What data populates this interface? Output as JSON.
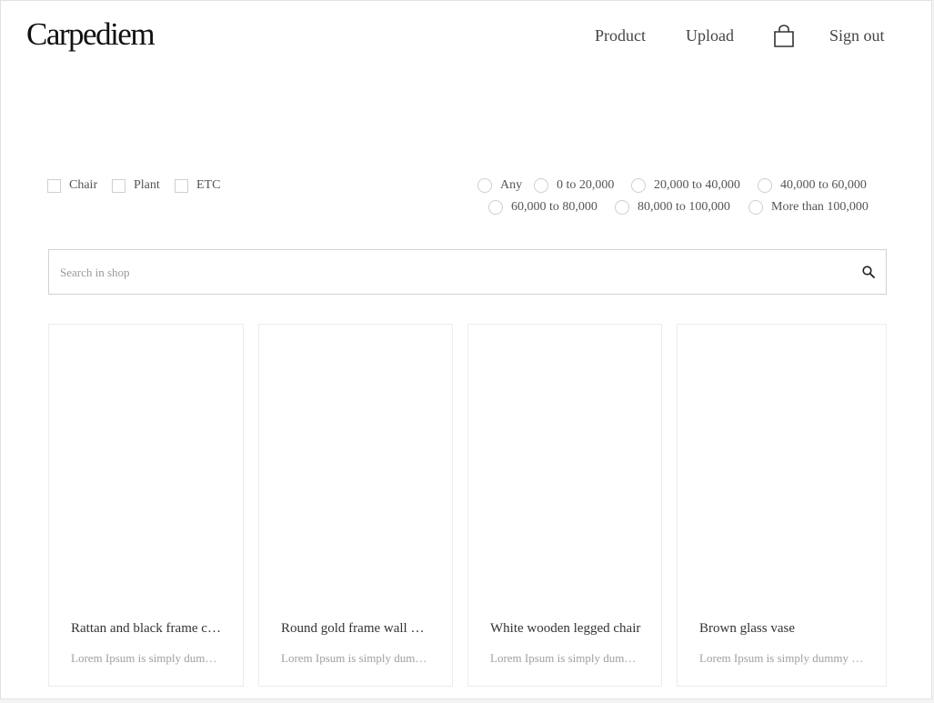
{
  "header": {
    "logo": "Carpediem",
    "nav": {
      "product": "Product",
      "upload": "Upload",
      "sign_out": "Sign out"
    },
    "cart_icon": "shopping-bag-icon"
  },
  "filters": {
    "categories": [
      {
        "label": "Chair",
        "checked": false
      },
      {
        "label": "Plant",
        "checked": false
      },
      {
        "label": "ETC",
        "checked": false
      }
    ],
    "price_ranges": [
      {
        "label": "Any",
        "selected": false
      },
      {
        "label": "0 to 20,000",
        "selected": false
      },
      {
        "label": "20,000 to 40,000",
        "selected": false
      },
      {
        "label": "40,000 to 60,000",
        "selected": false
      },
      {
        "label": "60,000 to 80,000",
        "selected": false
      },
      {
        "label": "80,000 to 100,000",
        "selected": false
      },
      {
        "label": "More than 100,000",
        "selected": false
      }
    ]
  },
  "search": {
    "placeholder": "Search in shop",
    "value": "",
    "icon": "search-icon"
  },
  "products": [
    {
      "title": "Rattan and black frame chair",
      "description": "Lorem Ipsum is simply dummy text"
    },
    {
      "title": "Round gold frame wall mirror",
      "description": "Lorem Ipsum is simply dummy text"
    },
    {
      "title": "White wooden legged chair",
      "description": "Lorem Ipsum is simply dummy text"
    },
    {
      "title": "Brown glass vase",
      "description": "Lorem Ipsum is simply dummy text"
    }
  ],
  "colors": {
    "border": "#e2e2e2",
    "text": "#333333",
    "muted": "#a0a0a0"
  }
}
